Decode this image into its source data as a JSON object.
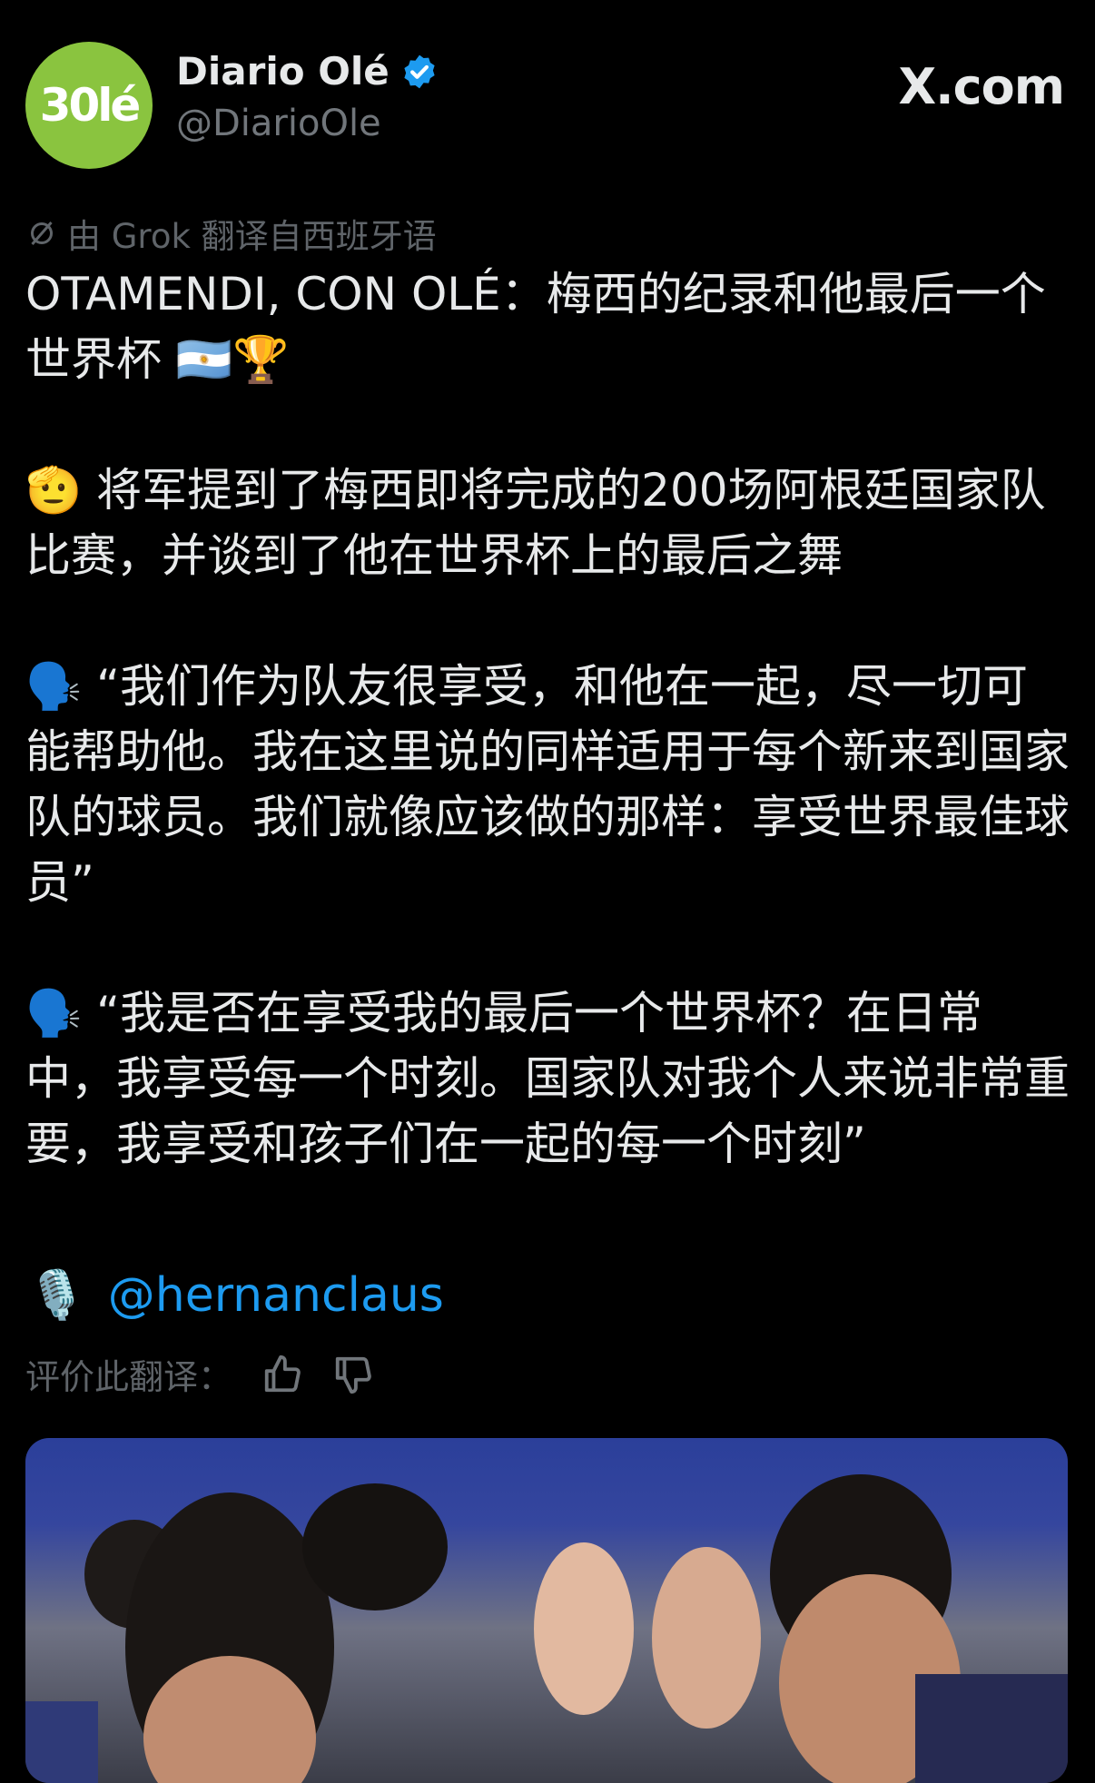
{
  "author": {
    "avatar_text": "30lé",
    "display_name": "Diario Olé",
    "handle": "@DiarioOle",
    "verified": true,
    "avatar_color": "#8ac43f"
  },
  "site_label": "X.com",
  "translation_notice": "由 Grok 翻译自西班牙语",
  "post": {
    "paragraphs": [
      "OTAMENDI, CON OLÉ：梅西的纪录和他最后一个世界杯 🇦🇷🏆",
      "🫡 将军提到了梅西即将完成的200场阿根廷国家队比赛，并谈到了他在世界杯上的最后之舞",
      "🗣️ “我们作为队友很享受，和他在一起，尽一切可能帮助他。我在这里说的同样适用于每个新来到国家队的球员。我们就像应该做的那样：享受世界最佳球员”",
      "🗣️ “我是否在享受我的最后一个世界杯？在日常中，我享受每一个时刻。国家队对我个人来说非常重要，我享受和孩子们在一起的每一个时刻”"
    ],
    "mention_icon": "🎙️",
    "mention": "@hernanclaus"
  },
  "rate_label": "评价此翻译：",
  "colors": {
    "link": "#1d9bf0",
    "muted": "#71767b",
    "verified": "#1d9bf0"
  }
}
